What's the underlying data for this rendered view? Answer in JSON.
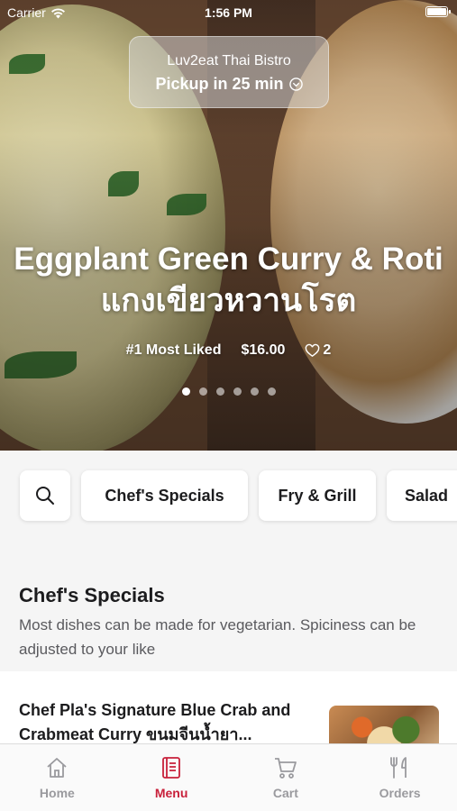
{
  "status_bar": {
    "carrier": "Carrier",
    "time": "1:56 PM"
  },
  "store": {
    "name": "Luv2eat Thai Bistro",
    "pickup": "Pickup in 25 min"
  },
  "hero": {
    "title": "Eggplant Green Curry & Roti แกงเขียวหวานโรต",
    "badge": "#1 Most Liked",
    "price": "$16.00",
    "likes": "2",
    "slide_count": 6,
    "active_slide": 0
  },
  "categories": [
    "Chef's Specials",
    "Fry & Grill",
    "Salad"
  ],
  "section": {
    "title": "Chef's Specials",
    "description": "Most dishes can be made for vegetarian. Spiciness can be adjusted to your like"
  },
  "menu_item": {
    "title": "Chef Pla's Signature Blue Crab and Crabmeat Curry ขนมจีนน้ำยา..."
  },
  "tabs": [
    {
      "label": "Home",
      "icon": "home-icon"
    },
    {
      "label": "Menu",
      "icon": "menu-icon"
    },
    {
      "label": "Cart",
      "icon": "cart-icon"
    },
    {
      "label": "Orders",
      "icon": "orders-icon"
    }
  ],
  "colors": {
    "accent": "#c8203a",
    "inactive_tab": "#9a9a9e"
  }
}
